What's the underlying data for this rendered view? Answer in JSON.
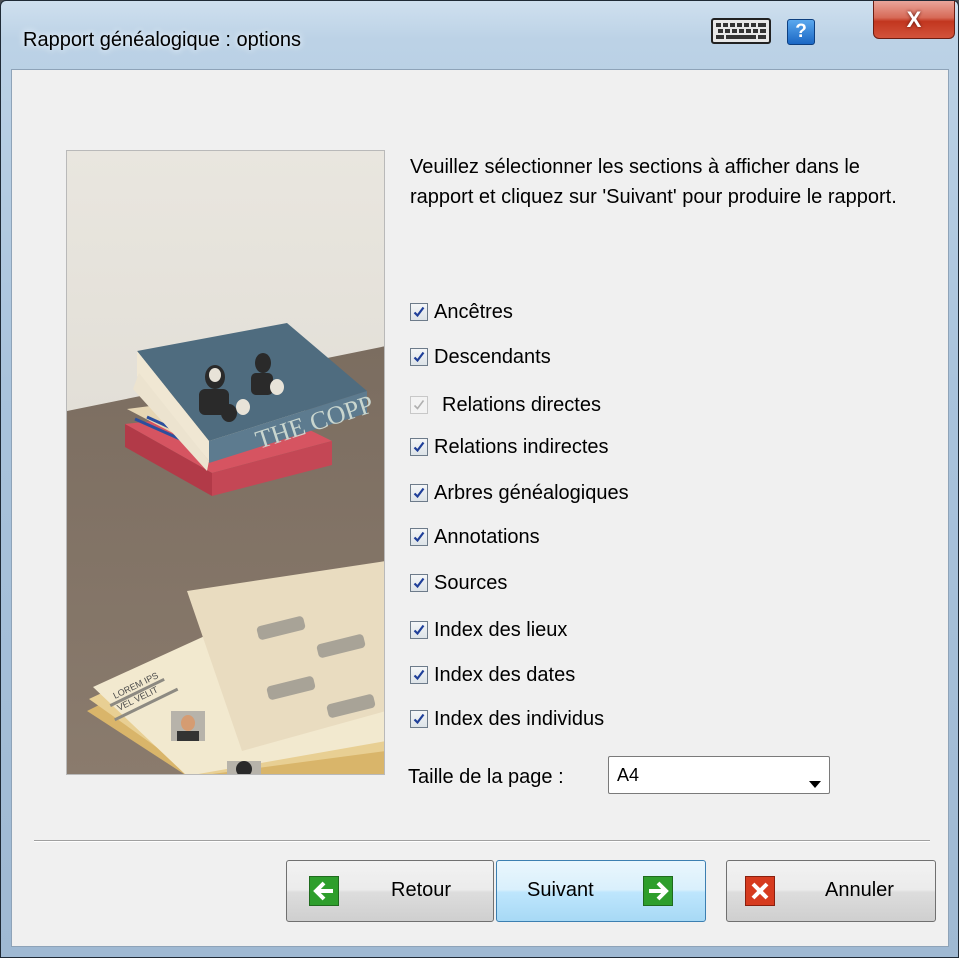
{
  "window": {
    "title": "Rapport généalogique : options",
    "close_label": "X",
    "help_label": "?"
  },
  "instructions": "Veuillez sélectionner les sections à afficher dans le rapport et cliquez sur 'Suivant' pour produire le rapport.",
  "options": [
    {
      "label": "Ancêtres",
      "checked": true,
      "enabled": true
    },
    {
      "label": "Descendants",
      "checked": true,
      "enabled": true
    },
    {
      "label": "Relations directes",
      "checked": true,
      "enabled": false
    },
    {
      "label": "Relations indirectes",
      "checked": true,
      "enabled": true
    },
    {
      "label": "Arbres généalogiques",
      "checked": true,
      "enabled": true
    },
    {
      "label": "Annotations",
      "checked": true,
      "enabled": true
    },
    {
      "label": "Sources",
      "checked": true,
      "enabled": true
    },
    {
      "label": "Index des lieux",
      "checked": true,
      "enabled": true
    },
    {
      "label": "Index des dates",
      "checked": true,
      "enabled": true
    },
    {
      "label": "Index des individus",
      "checked": true,
      "enabled": true
    }
  ],
  "page_size": {
    "label": "Taille de la page :",
    "value": "A4"
  },
  "buttons": {
    "back": "Retour",
    "next": "Suivant",
    "cancel": "Annuler"
  },
  "illustration": {
    "book_spine_text": "THE COPP",
    "paper_text_1": "LOREM IPS",
    "paper_text_2": "VEL VELIT"
  },
  "colors": {
    "check": "#1f3f99",
    "arrow_green": "#2e9e2c",
    "cancel_red": "#d63b1f",
    "focus_blue": "#3c7fb1"
  }
}
